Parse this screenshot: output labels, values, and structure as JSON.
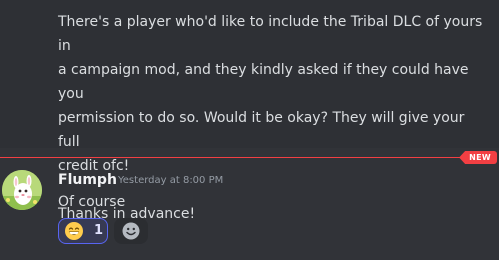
{
  "previous_message": {
    "lines": [
      "There's a player who'd like to include the Tribal DLC of yours in",
      "a campaign mod, and they kindly asked if they could have you",
      "permission to do so. Would it be okay? They will give your full",
      "credit ofc!",
      "Thanks in advance!"
    ]
  },
  "divider": {
    "badge": "NEW",
    "color": "#f23f43"
  },
  "reply": {
    "username": "Flumph",
    "timestamp": "Yesterday at 8:00 PM",
    "text": "Of course",
    "avatar_icon": "avatar-image"
  },
  "reactions": [
    {
      "emoji": "grinning-face-icon",
      "count": "1",
      "selected": true
    }
  ],
  "add_reaction": {
    "icon": "add-reaction-icon"
  },
  "colors": {
    "background": "#313338",
    "accent": "#5865f2",
    "text": "#dbdee1",
    "muted": "#949ba4"
  }
}
